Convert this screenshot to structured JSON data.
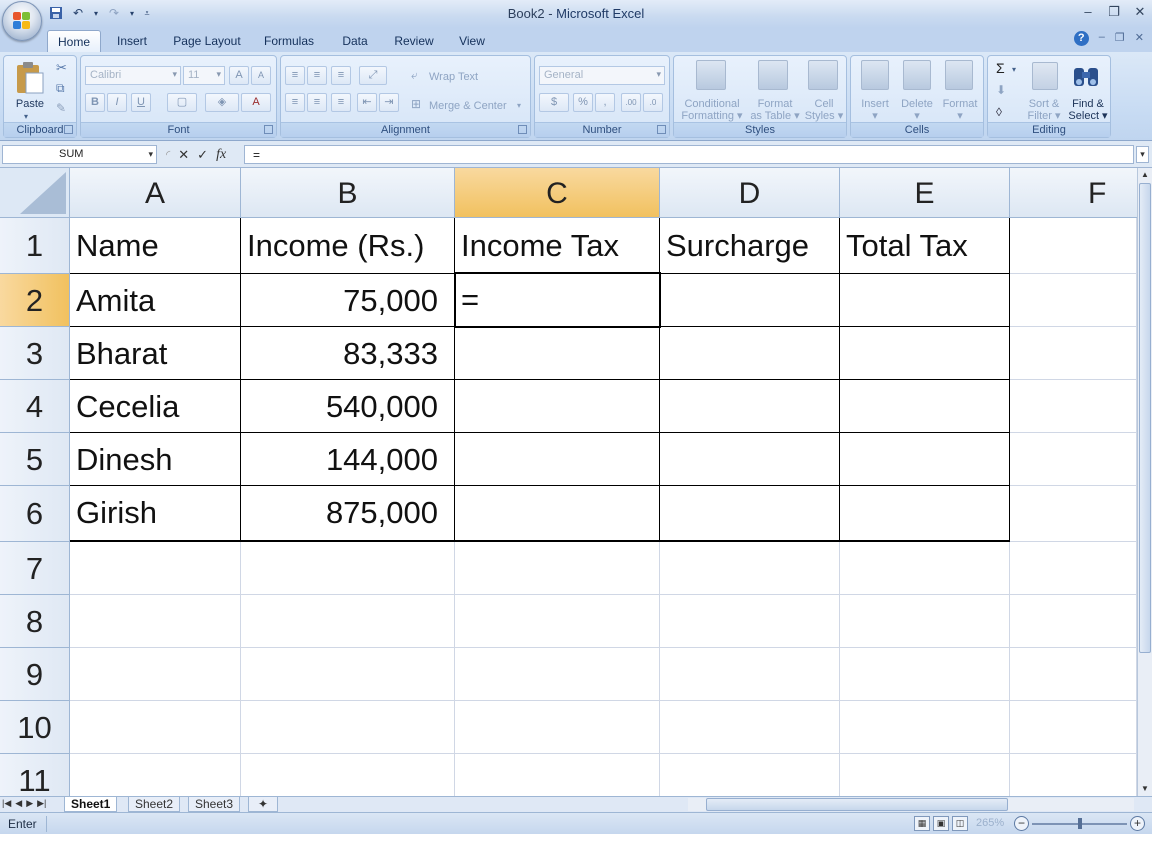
{
  "window": {
    "doc_name": "Book2",
    "separator": " - ",
    "app_name": "Microsoft Excel",
    "controls": [
      "–",
      "❐",
      "✕"
    ]
  },
  "tabs": [
    "Home",
    "Insert",
    "Page Layout",
    "Formulas",
    "Data",
    "Review",
    "View"
  ],
  "active_tab": "Home",
  "ribbon": {
    "clipboard": {
      "label": "Clipboard",
      "paste": "Paste"
    },
    "font": {
      "label": "Font",
      "font_name": "Calibri",
      "font_size": "11",
      "bold": "B",
      "italic": "I",
      "underline": "U",
      "grow": "A",
      "shrink": "A"
    },
    "alignment": {
      "label": "Alignment",
      "wrap_text": "Wrap Text",
      "merge_center": "Merge & Center"
    },
    "number": {
      "label": "Number",
      "format": "General",
      "currency": "$",
      "percent": "%",
      "comma": ","
    },
    "styles": {
      "label": "Styles",
      "conditional_l1": "Conditional",
      "conditional_l2": "Formatting",
      "format_table_l1": "Format",
      "format_table_l2": "as Table",
      "cell_styles_l1": "Cell",
      "cell_styles_l2": "Styles"
    },
    "cells": {
      "label": "Cells",
      "insert": "Insert",
      "delete": "Delete",
      "format": "Format"
    },
    "editing": {
      "label": "Editing",
      "sort_l1": "Sort &",
      "sort_l2": "Filter",
      "find_l1": "Find &",
      "find_l2": "Select",
      "sigma": "Σ"
    }
  },
  "formula_bar": {
    "name_box": "SUM",
    "cancel": "✕",
    "enter": "✓",
    "fx": "fx",
    "formula": "="
  },
  "columns": [
    "A",
    "B",
    "C",
    "D",
    "E",
    "F"
  ],
  "selected_column": "C",
  "rows": [
    "1",
    "2",
    "3",
    "4",
    "5",
    "6",
    "7",
    "8",
    "9",
    "10",
    "11"
  ],
  "selected_row": "2",
  "table": {
    "headers": [
      "Name",
      "Income (Rs.)",
      "Income Tax",
      "Surcharge",
      "Total Tax"
    ],
    "records": [
      {
        "name": "Amita",
        "income": "75,000",
        "income_tax": "="
      },
      {
        "name": "Bharat",
        "income": "83,333",
        "income_tax": ""
      },
      {
        "name": "Cecelia",
        "income": "540,000",
        "income_tax": ""
      },
      {
        "name": "Dinesh",
        "income": "144,000",
        "income_tax": ""
      },
      {
        "name": "Girish",
        "income": "875,000",
        "income_tax": ""
      }
    ]
  },
  "sheets": [
    "Sheet1",
    "Sheet2",
    "Sheet3"
  ],
  "active_sheet": "Sheet1",
  "status": {
    "mode": "Enter",
    "zoom": "265%"
  }
}
